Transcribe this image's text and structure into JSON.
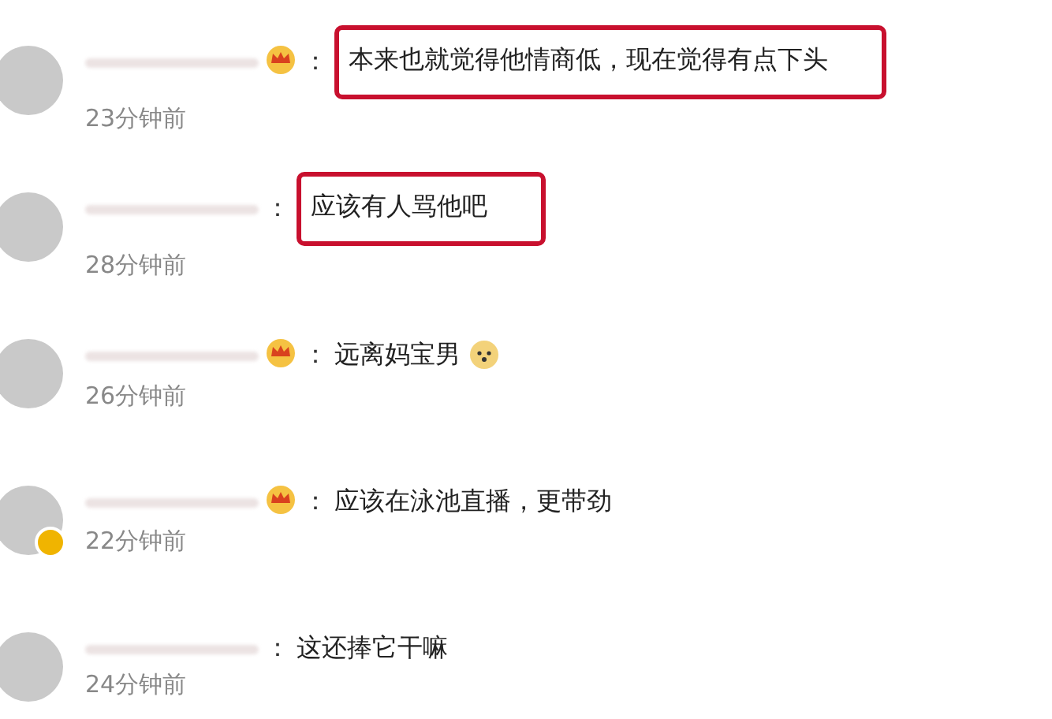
{
  "comments": [
    {
      "verified": false,
      "badge": true,
      "colon": "：",
      "text": "本来也就觉得他情商低，现在觉得有点下头",
      "emoji": false,
      "highlighted": true,
      "time": "23分钟前"
    },
    {
      "verified": false,
      "badge": false,
      "colon": "：",
      "text": "应该有人骂他吧",
      "emoji": false,
      "highlighted": true,
      "time": "28分钟前"
    },
    {
      "verified": false,
      "badge": true,
      "colon": "：",
      "text": "远离妈宝男",
      "emoji": true,
      "highlighted": false,
      "time": "26分钟前"
    },
    {
      "verified": true,
      "badge": true,
      "colon": "：",
      "text": "应该在泳池直播，更带劲",
      "emoji": false,
      "highlighted": false,
      "time": "22分钟前"
    },
    {
      "verified": false,
      "badge": false,
      "colon": "：",
      "text": "这还捧它干嘛",
      "emoji": false,
      "highlighted": false,
      "time": "24分钟前"
    }
  ]
}
